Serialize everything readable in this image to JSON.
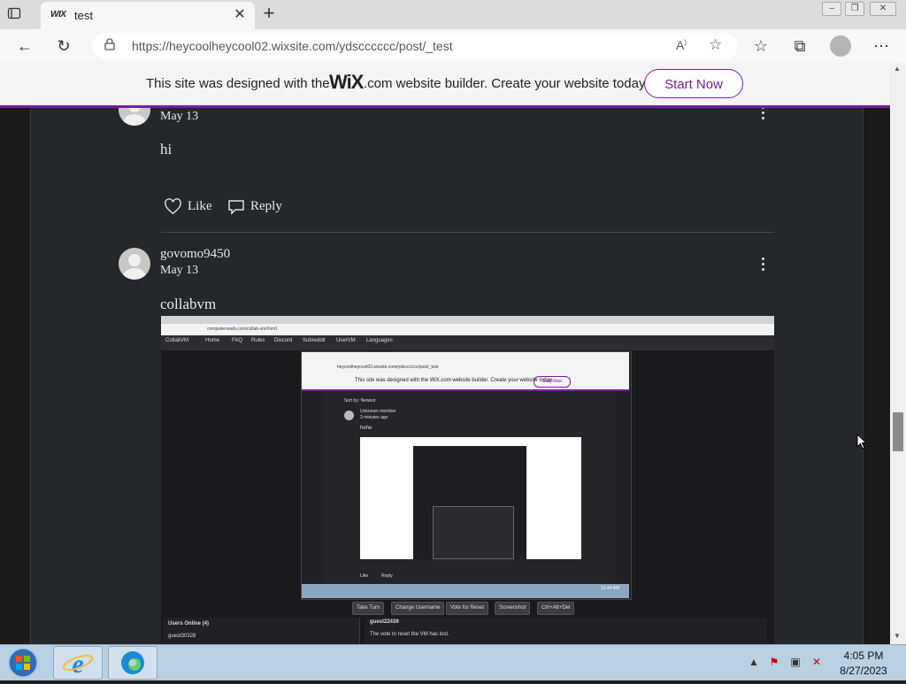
{
  "browser": {
    "tab_title": "test",
    "tab_favicon": "WIX",
    "url": "https://heycoolheycool02.wixsite.com/ydscccccc/post/_test"
  },
  "wix_banner": {
    "text_before": "This site was designed with the",
    "logo": "WiX",
    "text_after": ".com website builder. Create your website today.",
    "button": "Start Now"
  },
  "comments": [
    {
      "date": "May 13",
      "text": "hi",
      "like_label": "Like",
      "reply_label": "Reply"
    },
    {
      "author": "govomo9450",
      "date": "May 13",
      "text": "collabvm"
    }
  ],
  "embedded": {
    "url": "computernewb.com/collab-vm/#vm1",
    "nav": [
      "CollabVM",
      "Home",
      "FAQ",
      "Rules",
      "Discord",
      "Subreddit",
      "UserVM",
      "Languages"
    ],
    "vm_url": "heycoolheycool02.wixsite.com/ydscccccc/post/_test",
    "vm_banner": "This site was designed with the WiX.com website builder. Create your website today.",
    "vm_start": "Start Now",
    "sort": "Sort by: Newest",
    "vm_author": "Unknown member",
    "vm_time": "3 minutes ago",
    "vm_text": "hehe",
    "vm_like": "Like",
    "vm_reply": "Reply",
    "vm_clock": "12:44 AM",
    "buttons": [
      "Take Turn",
      "Change Username",
      "Vote for Reset",
      "Screenshot",
      "Ctrl+Alt+Del"
    ],
    "users_title": "Users Online (4)",
    "user1": "guest30328",
    "chat_user": "guest22439",
    "chat_msg": "The vote to reset the VM has lost."
  },
  "taskbar": {
    "time": "4:05 PM",
    "date": "8/27/2023"
  }
}
